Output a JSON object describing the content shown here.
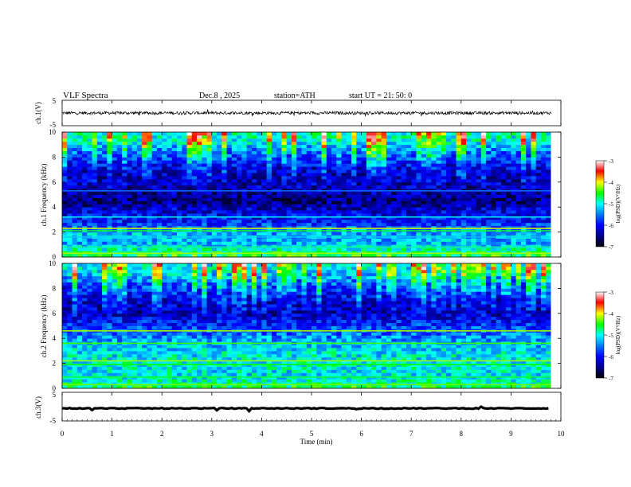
{
  "header": {
    "title": "VLF  Spectra",
    "date": "Dec.8  , 2025",
    "station": "station=ATH",
    "start_ut": "start  UT  =    21: 50: 0"
  },
  "colors": {
    "waveform": "#000000",
    "axis": "#000000",
    "colormap": [
      "#000000",
      "#00008b",
      "#0000ff",
      "#0080ff",
      "#00ffff",
      "#00ff00",
      "#ffff00",
      "#ff0000",
      "#ffffff"
    ]
  },
  "chart_data": [
    {
      "type": "line",
      "name": "channel-1-waveform",
      "ylabel": "ch.1(V)",
      "ylim": [
        -5,
        5
      ],
      "yticks": [
        "5",
        "-5"
      ],
      "description": "noisy baseline near 0 V with small spikes",
      "baseline": 0.0,
      "noise_amplitude": 0.6,
      "x": [
        0,
        1,
        2,
        3,
        4,
        5,
        6,
        7,
        8,
        9,
        9.8
      ],
      "y": [
        0,
        0,
        0,
        0,
        0,
        0,
        0,
        0,
        0,
        0,
        0
      ]
    },
    {
      "type": "heatmap",
      "name": "channel-1-spectrogram",
      "ylabel": "ch.1  Frequency  (kHz)",
      "ylim": [
        0,
        10
      ],
      "yticks": [
        "0",
        "2",
        "4",
        "6",
        "8",
        "10"
      ],
      "xlim": [
        0,
        10
      ],
      "data_end_min": 9.8,
      "colorbar": {
        "label": "log(PSD)(V²/Hz)",
        "range": [
          -7,
          -3
        ],
        "ticks": [
          "-3",
          "-4",
          "-5",
          "-6",
          "-7"
        ]
      },
      "background_logpsd": [
        {
          "f_khz": 0.0,
          "v": -4.5
        },
        {
          "f_khz": 0.5,
          "v": -4.8
        },
        {
          "f_khz": 1.0,
          "v": -5.3
        },
        {
          "f_khz": 2.0,
          "v": -5.3
        },
        {
          "f_khz": 2.5,
          "v": -5.8
        },
        {
          "f_khz": 3.5,
          "v": -6.1
        },
        {
          "f_khz": 4.5,
          "v": -6.5
        },
        {
          "f_khz": 5.5,
          "v": -6.3
        },
        {
          "f_khz": 7.0,
          "v": -6.2
        },
        {
          "f_khz": 8.5,
          "v": -5.5
        },
        {
          "f_khz": 9.3,
          "v": -5.0
        },
        {
          "f_khz": 10.0,
          "v": -4.9
        }
      ],
      "lines_khz": [
        {
          "f": 2.3,
          "v": -4.1
        },
        {
          "f": 2.1,
          "v": -4.6
        },
        {
          "f": 3.2,
          "v": -5.0
        },
        {
          "f": 1.6,
          "v": -5.2
        },
        {
          "f": 5.3,
          "v": -5.6
        },
        {
          "f": 0.8,
          "v": -4.8
        },
        {
          "f": 0.3,
          "v": -4.2
        }
      ],
      "sferic_bursts": "vertical impulsive streaks throughout, strongest above 6 kHz"
    },
    {
      "type": "heatmap",
      "name": "channel-2-spectrogram",
      "ylabel": "ch.2  Frequency  (kHz)",
      "ylim": [
        0,
        10
      ],
      "yticks": [
        "0",
        "2",
        "4",
        "6",
        "8",
        "10"
      ],
      "xlim": [
        0,
        10
      ],
      "data_end_min": 9.8,
      "colorbar": {
        "label": "log(PSD)(V²/Hz)",
        "range": [
          -7,
          -3
        ],
        "ticks": [
          "-3",
          "-4",
          "-5",
          "-6",
          "-7"
        ]
      },
      "background_logpsd": [
        {
          "f_khz": 0.0,
          "v": -4.6
        },
        {
          "f_khz": 0.5,
          "v": -4.9
        },
        {
          "f_khz": 1.0,
          "v": -5.1
        },
        {
          "f_khz": 2.0,
          "v": -5.0
        },
        {
          "f_khz": 3.0,
          "v": -5.1
        },
        {
          "f_khz": 4.0,
          "v": -5.4
        },
        {
          "f_khz": 5.0,
          "v": -5.8
        },
        {
          "f_khz": 6.0,
          "v": -6.3
        },
        {
          "f_khz": 7.0,
          "v": -6.2
        },
        {
          "f_khz": 8.5,
          "v": -5.6
        },
        {
          "f_khz": 9.3,
          "v": -5.1
        },
        {
          "f_khz": 10.0,
          "v": -5.0
        }
      ],
      "lines_khz": [
        {
          "f": 4.6,
          "v": -4.2
        },
        {
          "f": 3.6,
          "v": -4.4
        },
        {
          "f": 2.2,
          "v": -4.2
        },
        {
          "f": 1.9,
          "v": -4.5
        },
        {
          "f": 0.9,
          "v": -4.6
        },
        {
          "f": 0.3,
          "v": -4.3
        }
      ],
      "sferic_bursts": "vertical impulsive streaks throughout, strongest above 6 kHz"
    },
    {
      "type": "line",
      "name": "channel-3-waveform",
      "ylabel": "ch.3(V)",
      "ylim": [
        -5,
        5
      ],
      "yticks": [
        "5",
        "-5"
      ],
      "description": "thick flat trace just below zero",
      "baseline": -0.6,
      "noise_amplitude": 0.15,
      "x": [
        0,
        9.8
      ],
      "y": [
        -0.6,
        -0.6
      ]
    }
  ],
  "x_axis": {
    "label": "Time  (min)",
    "ticks": [
      "0",
      "1",
      "2",
      "3",
      "4",
      "5",
      "6",
      "7",
      "8",
      "9",
      "10"
    ]
  }
}
